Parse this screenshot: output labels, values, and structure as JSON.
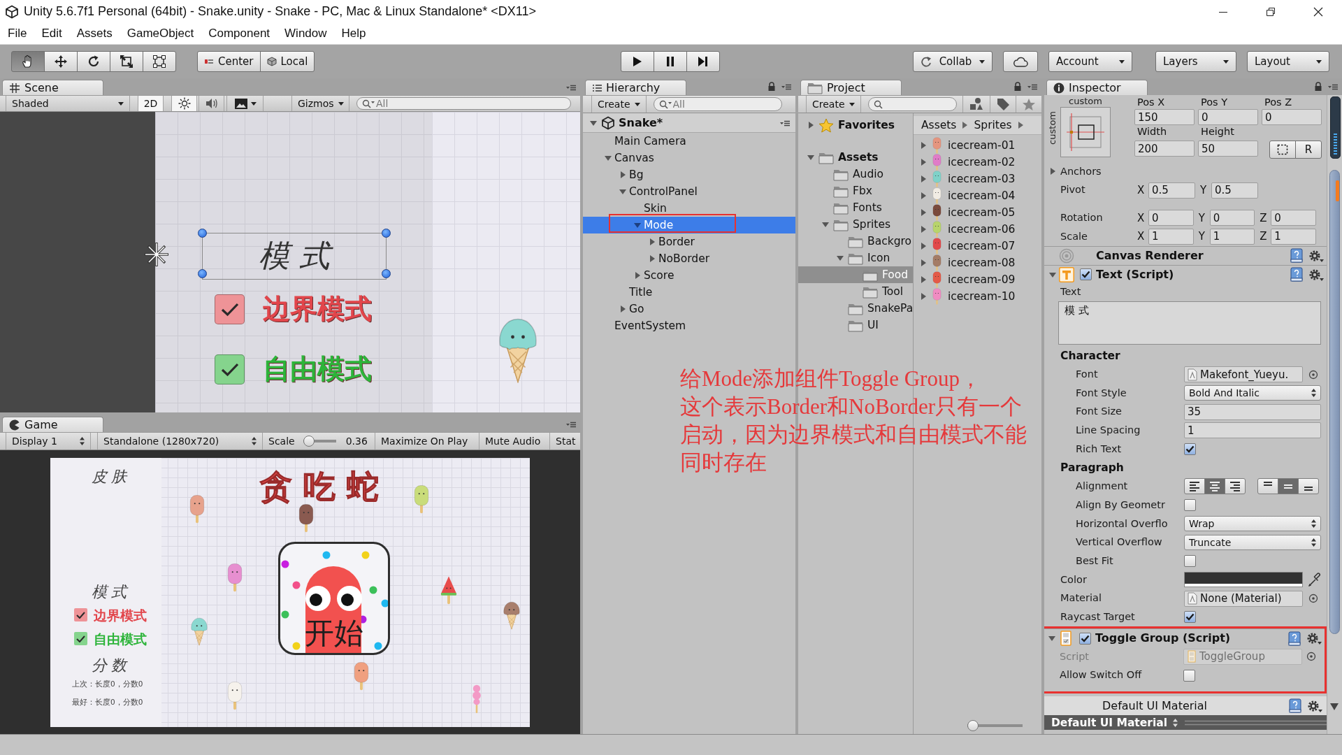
{
  "window": {
    "title": "Unity 5.6.7f1 Personal (64bit) - Snake.unity - Snake - PC, Mac & Linux Standalone* <DX11>"
  },
  "menu": [
    "File",
    "Edit",
    "Assets",
    "GameObject",
    "Component",
    "Window",
    "Help"
  ],
  "toolbar": {
    "transform_tools": [
      {
        "kind": "hand",
        "selected": true
      },
      {
        "kind": "move",
        "selected": false
      },
      {
        "kind": "rotate",
        "selected": false
      },
      {
        "kind": "scale",
        "selected": false
      },
      {
        "kind": "rect",
        "selected": false
      }
    ],
    "pivot_buttons": [
      {
        "kind": "pivot",
        "label": "Center"
      },
      {
        "kind": "space",
        "label": "Local"
      }
    ],
    "playback": [
      {
        "kind": "play",
        "selected": false
      },
      {
        "kind": "pause",
        "selected": false
      },
      {
        "kind": "step",
        "selected": false
      }
    ],
    "right": [
      {
        "kind": "collab",
        "label": "Collab"
      },
      {
        "kind": "cloud"
      },
      {
        "kind": "account",
        "label": "Account"
      },
      {
        "kind": "layers",
        "label": "Layers"
      },
      {
        "kind": "layout",
        "label": "Layout"
      }
    ]
  },
  "scene": {
    "tab": "Scene",
    "shading": "Shaded",
    "buttons": [
      {
        "kind": "dimension",
        "label": "2D",
        "on": true
      },
      {
        "kind": "lighting",
        "on": true
      },
      {
        "kind": "audio",
        "on": false
      },
      {
        "kind": "effects",
        "on": false
      }
    ],
    "gizmos": "Gizmos",
    "search": {
      "placeholder": "All"
    },
    "view": {
      "heading": "模 式",
      "toggles": [
        {
          "label": "边界模式",
          "checked": true,
          "color": "#e2454b"
        },
        {
          "label": "自由模式",
          "checked": true,
          "color": "#2db43a"
        }
      ]
    }
  },
  "game": {
    "tab": "Game",
    "display": "Display 1",
    "resolution": "Standalone (1280x720)",
    "scale": {
      "label": "Scale",
      "level": 0,
      "reading": "0.36"
    },
    "buttons": [
      "Maximize On Play",
      "Mute Audio",
      "Stat"
    ],
    "screen": {
      "skin_heading": "皮 肤",
      "title": "贪 吃 蛇",
      "start_label": "开始",
      "mode_heading": "模 式",
      "toggles": [
        {
          "label": "边界模式",
          "checked": true,
          "color": "#e2454b"
        },
        {
          "label": "自由模式",
          "checked": true,
          "color": "#2db43a"
        }
      ],
      "score_heading": "分 数",
      "scores": [
        "上次：长度0，分数0",
        "最好：长度0，分数0"
      ]
    }
  },
  "hierarchy": {
    "tab": "Hierarchy",
    "create": "Create",
    "search": {
      "placeholder": "All"
    },
    "scene": {
      "label": "Snake*",
      "expanded": true
    },
    "items": [
      {
        "label": "Main Camera",
        "selected": false,
        "highlighted": false
      },
      {
        "label": "Canvas",
        "selected": false,
        "highlighted": false,
        "expanded": true,
        "children": [
          {
            "label": "Bg",
            "selected": false,
            "highlighted": false,
            "expanded": false
          },
          {
            "label": "ControlPanel",
            "selected": false,
            "highlighted": false,
            "expanded": true,
            "children": [
              {
                "label": "Skin",
                "selected": false,
                "highlighted": false
              },
              {
                "label": "Mode",
                "selected": true,
                "highlighted": true,
                "expanded": true,
                "children": [
                  {
                    "label": "Border",
                    "selected": false,
                    "highlighted": false,
                    "expanded": false
                  },
                  {
                    "label": "NoBorder",
                    "selected": false,
                    "highlighted": false,
                    "expanded": false
                  }
                ]
              },
              {
                "label": "Score",
                "selected": false,
                "highlighted": false,
                "expanded": false
              }
            ]
          },
          {
            "label": "Title",
            "selected": false,
            "highlighted": false
          },
          {
            "label": "Go",
            "selected": false,
            "highlighted": false,
            "expanded": false
          }
        ]
      },
      {
        "label": "EventSystem",
        "selected": false,
        "highlighted": false
      }
    ]
  },
  "project": {
    "tab": "Project",
    "create": "Create",
    "folders": [
      {
        "kind": "favorites",
        "label": "Favorites",
        "expanded": false,
        "selected": false
      },
      {
        "kind": "root",
        "label": "Assets",
        "expanded": true,
        "selected": false,
        "children": [
          {
            "kind": "folder",
            "label": "Audio",
            "selected": false
          },
          {
            "kind": "folder",
            "label": "Fbx",
            "selected": false
          },
          {
            "kind": "folder",
            "label": "Fonts",
            "selected": false
          },
          {
            "kind": "folder",
            "label": "Sprites",
            "expanded": true,
            "selected": false,
            "children": [
              {
                "kind": "folder",
                "label": "Backgro",
                "selected": false
              },
              {
                "kind": "folder",
                "label": "Icon",
                "expanded": true,
                "selected": false,
                "children": [
                  {
                    "kind": "folder",
                    "label": "Food",
                    "selected": true
                  },
                  {
                    "kind": "folder",
                    "label": "Tool",
                    "selected": false
                  }
                ]
              },
              {
                "kind": "folder",
                "label": "SnakePa",
                "selected": false
              },
              {
                "kind": "folder",
                "label": "UI",
                "selected": false
              }
            ]
          }
        ]
      }
    ],
    "breadcrumb": [
      "Assets",
      "Sprites"
    ],
    "assets": [
      {
        "label": "icecream-01",
        "color": "#e5957f",
        "expanded": false
      },
      {
        "label": "icecream-02",
        "color": "#e07cc8",
        "expanded": false
      },
      {
        "label": "icecream-03",
        "color": "#7fd2c9",
        "expanded": false
      },
      {
        "label": "icecream-04",
        "color": "#f1ece4",
        "expanded": false
      },
      {
        "label": "icecream-05",
        "color": "#7a4a3c",
        "expanded": false
      },
      {
        "label": "icecream-06",
        "color": "#b8d46c",
        "expanded": false
      },
      {
        "label": "icecream-07",
        "color": "#e2484a",
        "expanded": false
      },
      {
        "label": "icecream-08",
        "color": "#a47c66",
        "expanded": false
      },
      {
        "label": "icecream-09",
        "color": "#e45a48",
        "expanded": false
      },
      {
        "label": "icecream-10",
        "color": "#f08cc2",
        "expanded": false
      }
    ],
    "thumbnail_size": {
      "level": 0
    }
  },
  "inspector": {
    "tab": "Inspector",
    "rect": {
      "preset_label": "custom",
      "preset_side_label": "custom",
      "position_labels": [
        "Pos X",
        "Pos Y",
        "Pos Z"
      ],
      "position_values": [
        "150",
        "0",
        "0"
      ],
      "size_labels": [
        "Width",
        "Height"
      ],
      "size_values": [
        "200",
        "50"
      ],
      "raw_button": "R"
    },
    "rows": [
      {
        "kind": "foldout",
        "label": "Anchors",
        "expanded": false
      },
      {
        "kind": "vector",
        "label": "Pivot",
        "axes": [
          {
            "axis": "X",
            "value": "0.5"
          },
          {
            "axis": "Y",
            "value": "0.5"
          }
        ]
      },
      {
        "kind": "vector",
        "label": "Rotation",
        "axes": [
          {
            "axis": "X",
            "value": "0"
          },
          {
            "axis": "Y",
            "value": "0"
          },
          {
            "axis": "Z",
            "value": "0"
          }
        ]
      },
      {
        "kind": "vector",
        "label": "Scale",
        "axes": [
          {
            "axis": "X",
            "value": "1"
          },
          {
            "axis": "Y",
            "value": "1"
          },
          {
            "axis": "Z",
            "value": "1"
          }
        ]
      }
    ],
    "components": [
      {
        "kind": "canvas_renderer",
        "title": "Canvas Renderer",
        "highlighted": false
      },
      {
        "kind": "text",
        "title": "Text (Script)",
        "expanded": true,
        "enabled": true,
        "highlighted": false,
        "fields": [
          {
            "kind": "textarea",
            "label": "Text",
            "value": "模 式"
          },
          {
            "kind": "header",
            "label": "Character",
            "children": [
              {
                "kind": "object",
                "label": "Font",
                "value": "Makefont_Yueyu."
              },
              {
                "kind": "dropdown",
                "label": "Font Style",
                "value": "Bold And Italic"
              },
              {
                "kind": "number",
                "label": "Font Size",
                "value": "35"
              },
              {
                "kind": "number",
                "label": "Line Spacing",
                "value": "1"
              },
              {
                "kind": "checkbox",
                "label": "Rich Text",
                "checked": true
              }
            ]
          },
          {
            "kind": "header",
            "label": "Paragraph",
            "children": [
              {
                "kind": "alignment",
                "label": "Alignment",
                "horizontal": [
                  {
                    "kind": "left",
                    "selected": false
                  },
                  {
                    "kind": "center",
                    "selected": true
                  },
                  {
                    "kind": "right",
                    "selected": false
                  }
                ],
                "vertical": [
                  {
                    "kind": "top",
                    "selected": false
                  },
                  {
                    "kind": "middle",
                    "selected": true
                  },
                  {
                    "kind": "bottom",
                    "selected": false
                  }
                ]
              },
              {
                "kind": "checkbox",
                "label": "Align By Geometr",
                "checked": false
              },
              {
                "kind": "dropdown",
                "label": "Horizontal Overflo",
                "value": "Wrap"
              },
              {
                "kind": "dropdown",
                "label": "Vertical Overflow",
                "value": "Truncate"
              },
              {
                "kind": "checkbox",
                "label": "Best Fit",
                "checked": false
              }
            ]
          },
          {
            "kind": "color",
            "label": "Color",
            "color": "#323232"
          },
          {
            "kind": "object",
            "label": "Material",
            "value": "None (Material)"
          },
          {
            "kind": "checkbox",
            "label": "Raycast Target",
            "checked": true
          }
        ]
      },
      {
        "kind": "toggle_group",
        "title": "Toggle Group (Script)",
        "expanded": true,
        "enabled": true,
        "highlighted": true,
        "fields": [
          {
            "kind": "script",
            "label": "Script",
            "value": "ToggleGroup",
            "disabled": true
          },
          {
            "kind": "checkbox",
            "label": "Allow Switch Off",
            "checked": false
          }
        ]
      }
    ],
    "material": {
      "header": "Default UI Material",
      "selector": "Default UI Material"
    }
  },
  "annotation": {
    "paragraphs": [
      "给Mode添加组件Toggle Group，",
      "这个表示Border和NoBorder只有一个启动，因为边界模式和自由模式不能同时存在"
    ]
  }
}
